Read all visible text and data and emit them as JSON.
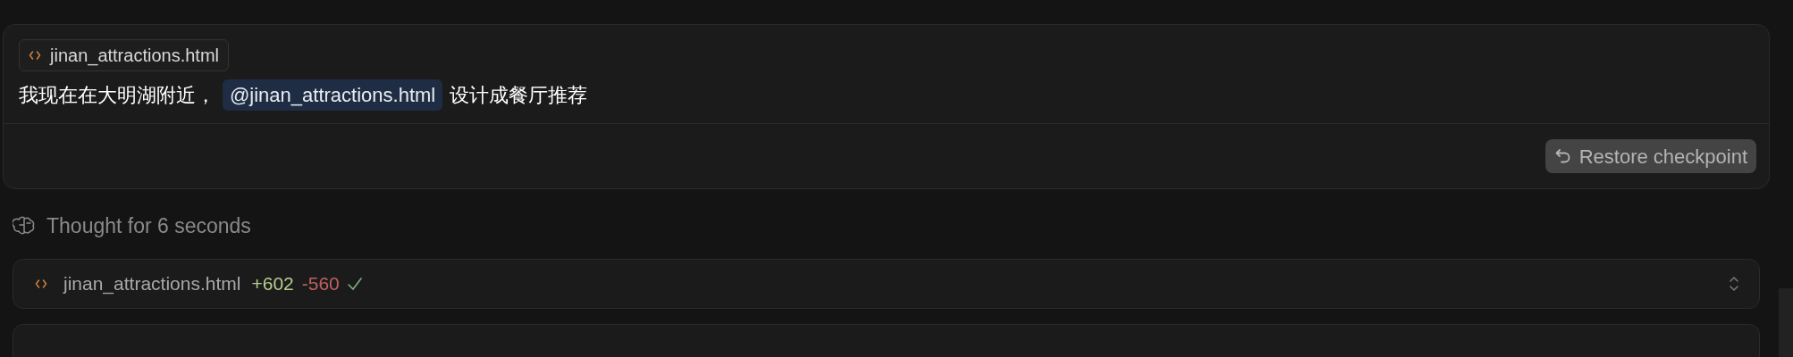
{
  "message": {
    "attachment": {
      "name": "jinan_attractions.html"
    },
    "parts": [
      {
        "kind": "text",
        "text": "我现在在大明湖附近，"
      },
      {
        "kind": "mention",
        "text": "@jinan_attractions.html"
      },
      {
        "kind": "text",
        "text": "设计成餐厅推荐"
      }
    ],
    "restore_button": "Restore checkpoint"
  },
  "thought": "Thought for 6 seconds",
  "file_change": {
    "name": "jinan_attractions.html",
    "added": "+602",
    "removed": "-560",
    "done": true
  }
}
